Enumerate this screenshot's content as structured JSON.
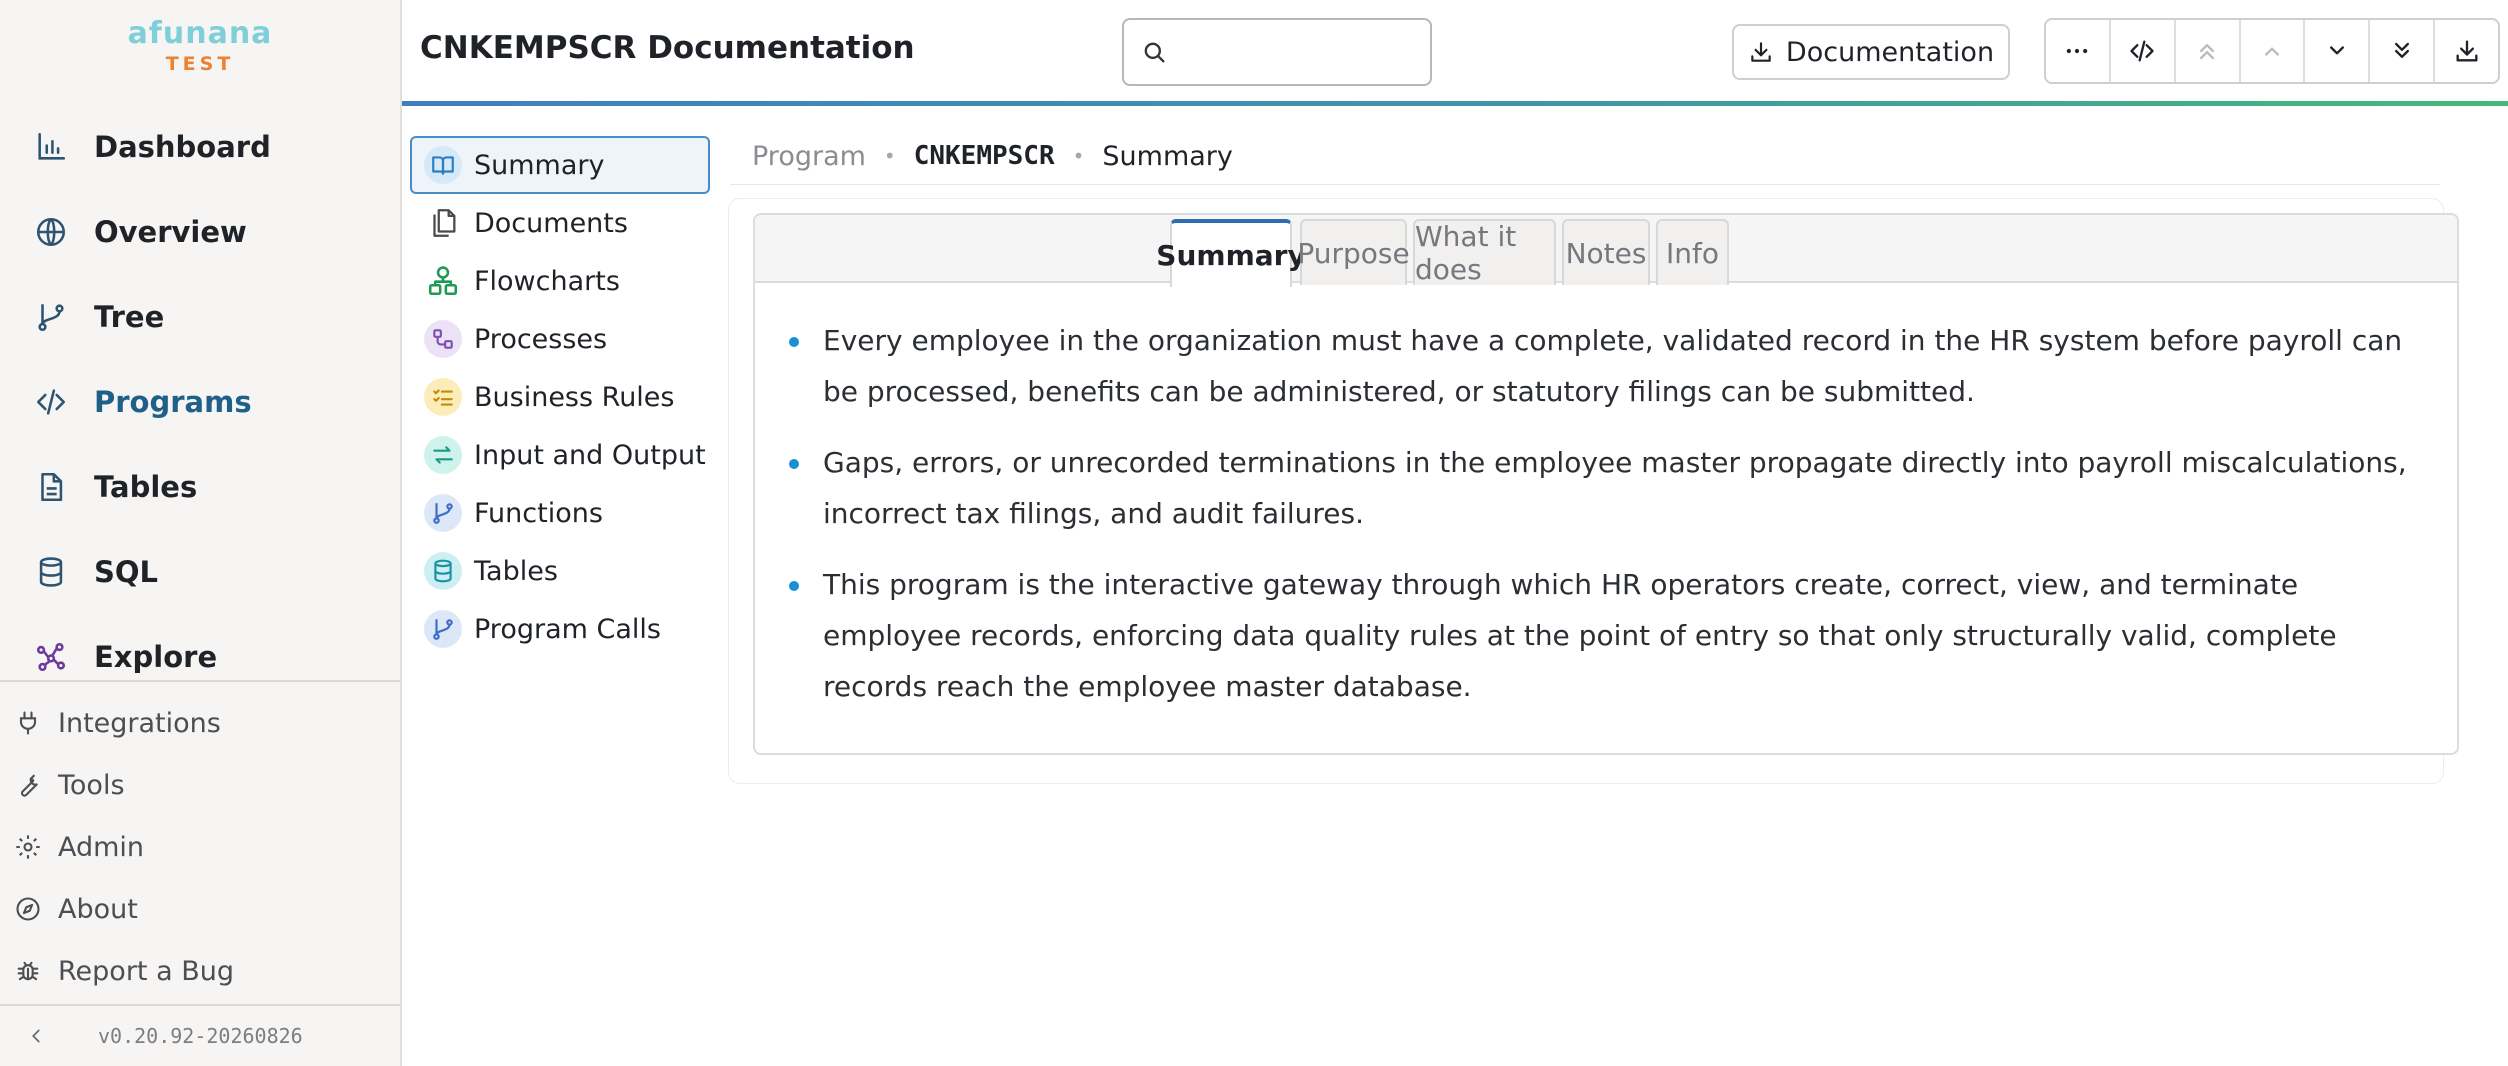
{
  "brand": {
    "name": "afunana",
    "env": "TEST"
  },
  "sidebar": {
    "main": [
      {
        "label": "Dashboard",
        "icon": "bar-chart-icon"
      },
      {
        "label": "Overview",
        "icon": "globe-icon"
      },
      {
        "label": "Tree",
        "icon": "git-branch-icon"
      },
      {
        "label": "Programs",
        "icon": "code-icon",
        "active": true
      },
      {
        "label": "Tables",
        "icon": "document-icon"
      },
      {
        "label": "SQL",
        "icon": "database-icon"
      },
      {
        "label": "Explore",
        "icon": "graph-icon"
      }
    ],
    "secondary": [
      {
        "label": "Integrations",
        "icon": "plug-icon"
      },
      {
        "label": "Tools",
        "icon": "wrench-icon"
      },
      {
        "label": "Admin",
        "icon": "gear-icon"
      },
      {
        "label": "About",
        "icon": "compass-icon"
      },
      {
        "label": "Report a Bug",
        "icon": "bug-icon"
      }
    ],
    "version": "v0.20.92-20260826"
  },
  "header": {
    "title": "CNKEMPSCR Documentation",
    "search_placeholder": "",
    "doc_button_label": "Documentation",
    "toolbar": [
      "more-icon",
      "code-icon",
      "double-chevron-up-icon",
      "chevron-up-icon",
      "chevron-down-icon",
      "double-chevron-down-icon",
      "download-icon"
    ]
  },
  "section_nav": [
    {
      "label": "Summary",
      "icon": "book-icon",
      "active": true
    },
    {
      "label": "Documents",
      "icon": "files-icon"
    },
    {
      "label": "Flowcharts",
      "icon": "flowchart-icon"
    },
    {
      "label": "Processes",
      "icon": "workflow-icon"
    },
    {
      "label": "Business Rules",
      "icon": "list-check-icon"
    },
    {
      "label": "Input and Output",
      "icon": "arrows-icon"
    },
    {
      "label": "Functions",
      "icon": "branch-icon"
    },
    {
      "label": "Tables",
      "icon": "database-icon"
    },
    {
      "label": "Program Calls",
      "icon": "branch-icon"
    }
  ],
  "breadcrumb": {
    "part1": "Program",
    "part2": "CNKEMPSCR",
    "part3": "Summary"
  },
  "tabs": [
    "Summary",
    "Purpose",
    "What it does",
    "Notes",
    "Info"
  ],
  "summary_bullets": [
    "Every employee in the organization must have a complete, validated record in the HR system before payroll can be processed, benefits can be administered, or statutory filings can be submitted.",
    "Gaps, errors, or unrecorded terminations in the employee master propagate directly into payroll miscalculations, incorrect tax filings, and audit failures.",
    "This program is the interactive gateway through which HR operators create, correct, view, and terminate employee records, enforcing data quality rules at the point of entry so that only structurally valid, complete records reach the employee master database."
  ],
  "colors": {
    "accent": "#2f6db2",
    "bullet": "#1a8fd6",
    "brand": "#7fcfd8",
    "env": "#ee8233"
  }
}
